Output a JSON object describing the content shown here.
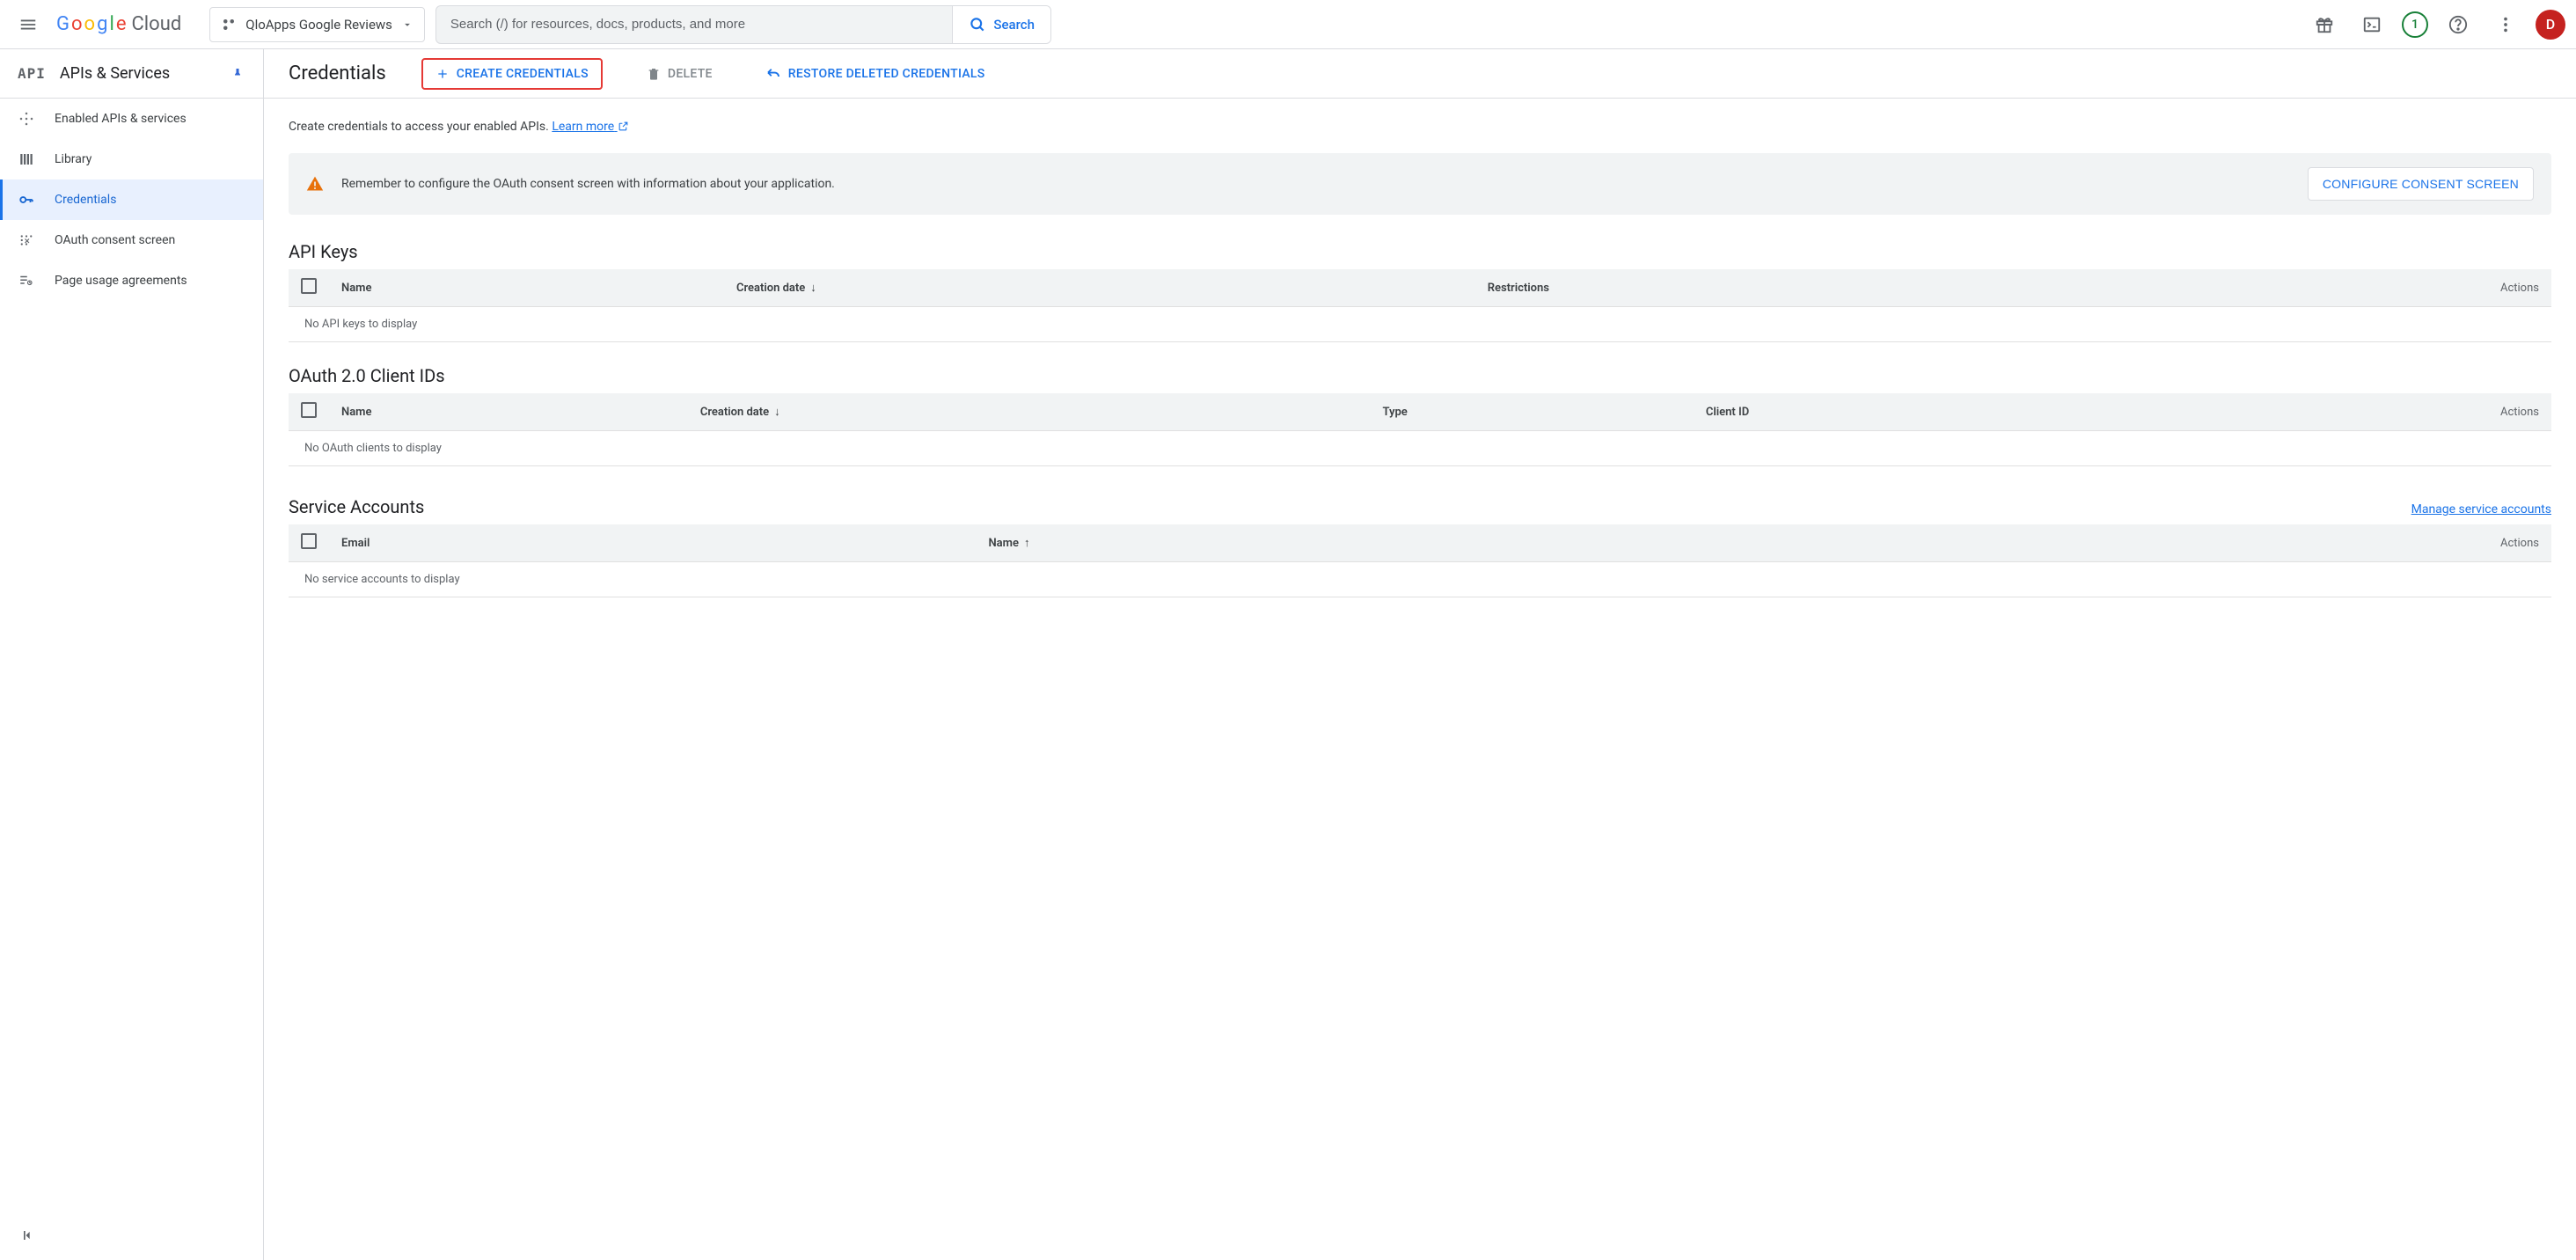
{
  "header": {
    "logo_cloud": "Cloud",
    "project_name": "QloApps Google Reviews",
    "search_placeholder": "Search (/) for resources, docs, products, and more",
    "search_button": "Search",
    "notif_count": "1",
    "avatar_initial": "D"
  },
  "sidebar": {
    "head_title": "APIs & Services",
    "items": [
      {
        "label": "Enabled APIs & services"
      },
      {
        "label": "Library"
      },
      {
        "label": "Credentials"
      },
      {
        "label": "OAuth consent screen"
      },
      {
        "label": "Page usage agreements"
      }
    ]
  },
  "main": {
    "page_title": "Credentials",
    "create_btn": "CREATE CREDENTIALS",
    "delete_btn": "DELETE",
    "restore_btn": "RESTORE DELETED CREDENTIALS",
    "intro_text": "Create credentials to access your enabled APIs. ",
    "learn_more": "Learn more",
    "alert_text": "Remember to configure the OAuth consent screen with information about your application.",
    "consent_btn": "CONFIGURE CONSENT SCREEN",
    "sections": {
      "apiKeys": {
        "title": "API Keys",
        "cols": {
          "name": "Name",
          "creation": "Creation date",
          "restrictions": "Restrictions",
          "actions": "Actions"
        },
        "empty": "No API keys to display"
      },
      "oauth": {
        "title": "OAuth 2.0 Client IDs",
        "cols": {
          "name": "Name",
          "creation": "Creation date",
          "type": "Type",
          "client": "Client ID",
          "actions": "Actions"
        },
        "empty": "No OAuth clients to display"
      },
      "service": {
        "title": "Service Accounts",
        "manage": "Manage service accounts",
        "cols": {
          "email": "Email",
          "name": "Name",
          "actions": "Actions"
        },
        "empty": "No service accounts to display"
      }
    }
  }
}
